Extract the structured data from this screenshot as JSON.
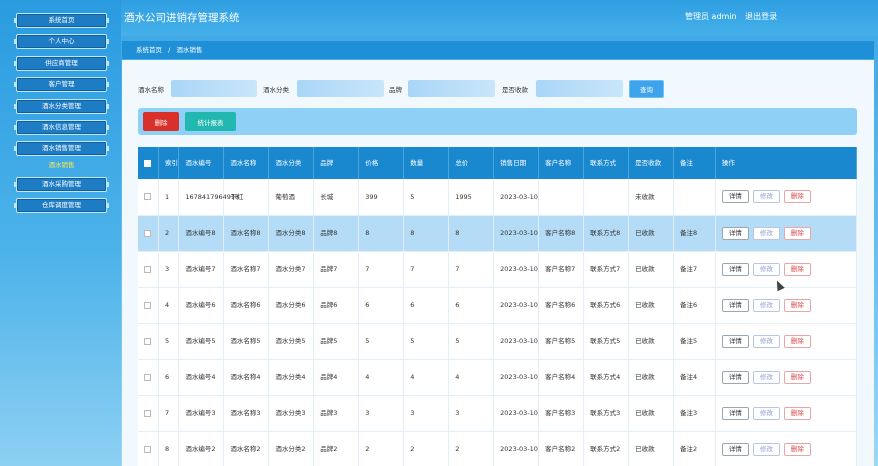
{
  "app": {
    "title": "酒水公司进销存管理系统"
  },
  "header": {
    "user_label": "管理员 admin",
    "logout_label": "退出登录"
  },
  "sidebar": {
    "items": [
      {
        "label": "系统首页"
      },
      {
        "label": "个人中心"
      },
      {
        "label": "供应商管理"
      },
      {
        "label": "客户管理"
      },
      {
        "label": "酒水分类管理"
      },
      {
        "label": "酒水信息管理"
      },
      {
        "label": "酒水销售管理"
      }
    ],
    "submenu_label": "酒水销售",
    "items_after": [
      {
        "label": "酒水采购管理"
      },
      {
        "label": "仓库调度管理"
      }
    ]
  },
  "breadcrumb": {
    "home": "系统首页",
    "separator": "/",
    "current": "酒水销售"
  },
  "search": {
    "name_label": "酒水名称",
    "category_label": "酒水分类",
    "brand_label": "品牌",
    "status_label": "是否收款",
    "button_label": "查询"
  },
  "actions": {
    "delete_label": "删除",
    "stats_label": "统计报表"
  },
  "table": {
    "headers": [
      "索引",
      "酒水编号",
      "酒水名称",
      "酒水分类",
      "品牌",
      "价格",
      "数量",
      "总价",
      "销售日期",
      "客户名称",
      "联系方式",
      "是否收款",
      "备注",
      "操作"
    ],
    "op_labels": {
      "detail": "详情",
      "edit": "修改",
      "delete": "删除"
    },
    "rows": [
      {
        "index": "1",
        "code": "1678417964918",
        "name": "干红",
        "category": "葡萄酒",
        "brand": "长城",
        "price": "399",
        "qty": "5",
        "total": "1995",
        "date": "2023-03-10",
        "customer": "",
        "contact": "",
        "paid": "未收款",
        "note": ""
      },
      {
        "index": "2",
        "code": "酒水编号8",
        "name": "酒水名称8",
        "category": "酒水分类8",
        "brand": "品牌8",
        "price": "8",
        "qty": "8",
        "total": "8",
        "date": "2023-03-10",
        "customer": "客户名称8",
        "contact": "联系方式8",
        "paid": "已收款",
        "note": "备注8"
      },
      {
        "index": "3",
        "code": "酒水编号7",
        "name": "酒水名称7",
        "category": "酒水分类7",
        "brand": "品牌7",
        "price": "7",
        "qty": "7",
        "total": "7",
        "date": "2023-03-10",
        "customer": "客户名称7",
        "contact": "联系方式7",
        "paid": "已收款",
        "note": "备注7"
      },
      {
        "index": "4",
        "code": "酒水编号6",
        "name": "酒水名称6",
        "category": "酒水分类6",
        "brand": "品牌6",
        "price": "6",
        "qty": "6",
        "total": "6",
        "date": "2023-03-10",
        "customer": "客户名称6",
        "contact": "联系方式6",
        "paid": "已收款",
        "note": "备注6"
      },
      {
        "index": "5",
        "code": "酒水编号5",
        "name": "酒水名称5",
        "category": "酒水分类5",
        "brand": "品牌5",
        "price": "5",
        "qty": "5",
        "total": "5",
        "date": "2023-03-10",
        "customer": "客户名称5",
        "contact": "联系方式5",
        "paid": "已收款",
        "note": "备注5"
      },
      {
        "index": "6",
        "code": "酒水编号4",
        "name": "酒水名称4",
        "category": "酒水分类4",
        "brand": "品牌4",
        "price": "4",
        "qty": "4",
        "total": "4",
        "date": "2023-03-10",
        "customer": "客户名称4",
        "contact": "联系方式4",
        "paid": "已收款",
        "note": "备注4"
      },
      {
        "index": "7",
        "code": "酒水编号3",
        "name": "酒水名称3",
        "category": "酒水分类3",
        "brand": "品牌3",
        "price": "3",
        "qty": "3",
        "total": "3",
        "date": "2023-03-10",
        "customer": "客户名称3",
        "contact": "联系方式3",
        "paid": "已收款",
        "note": "备注3"
      },
      {
        "index": "8",
        "code": "酒水编号2",
        "name": "酒水名称2",
        "category": "酒水分类2",
        "brand": "品牌2",
        "price": "2",
        "qty": "2",
        "total": "2",
        "date": "2023-03-10",
        "customer": "客户名称2",
        "contact": "联系方式2",
        "paid": "已收款",
        "note": "备注2"
      }
    ]
  },
  "colors": {
    "header_blue": "#1a88cf",
    "delete_red": "#d9302a",
    "stats_teal": "#22b8b0",
    "highlight_row": "#b5dcf7",
    "active_menu_text": "#ffe94d"
  }
}
